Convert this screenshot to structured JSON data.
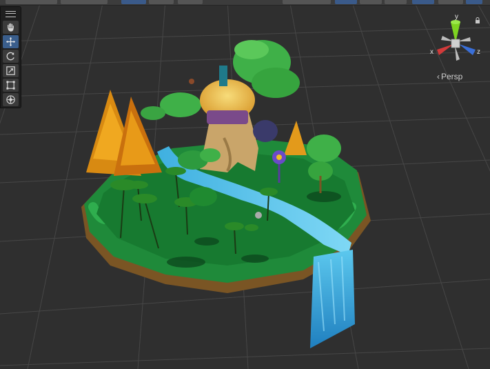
{
  "scene_view": {
    "projection_label": "Persp",
    "axes": {
      "y": "y",
      "x": "x",
      "z": "z"
    },
    "colors": {
      "background": "#2f2f2f",
      "grid": "#4a4a4a",
      "axis_x": "#d23a3a",
      "axis_y": "#7ed321",
      "axis_z": "#3a6fd8",
      "tool_active": "#3a5e8c"
    }
  },
  "tools": {
    "items": [
      {
        "name": "hand-tool",
        "icon": "hand-icon",
        "active": false
      },
      {
        "name": "move-tool",
        "icon": "move-icon",
        "active": true
      },
      {
        "name": "rotate-tool",
        "icon": "rotate-icon",
        "active": false
      },
      {
        "name": "scale-tool",
        "icon": "scale-icon",
        "active": false
      },
      {
        "name": "rect-tool",
        "icon": "rect-icon",
        "active": false
      },
      {
        "name": "transform-tool",
        "icon": "transform-icon",
        "active": false
      }
    ]
  }
}
